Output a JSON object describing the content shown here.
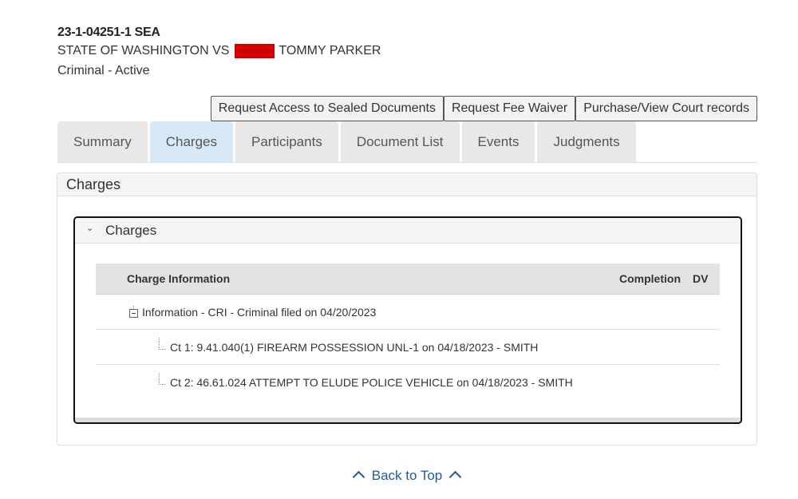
{
  "case": {
    "number": "23-1-04251-1 SEA",
    "title_prefix": "STATE OF WASHINGTON VS",
    "title_suffix": "TOMMY PARKER",
    "status": "Criminal - Active",
    "redaction_color": "#d40000"
  },
  "actions": {
    "sealed_docs": "Request Access to Sealed Documents",
    "fee_waiver": "Request Fee Waiver",
    "court_records": "Purchase/View Court records"
  },
  "tabs": [
    {
      "label": "Summary",
      "active": false
    },
    {
      "label": "Charges",
      "active": true
    },
    {
      "label": "Participants",
      "active": false
    },
    {
      "label": "Document List",
      "active": false
    },
    {
      "label": "Events",
      "active": false
    },
    {
      "label": "Judgments",
      "active": false
    }
  ],
  "panel": {
    "title": "Charges",
    "section_title": "Charges",
    "section_icon": "chevron-down-icon",
    "columns": {
      "info": "Charge Information",
      "completion": "Completion",
      "dv": "DV"
    },
    "filing": {
      "label": "Information - CRI - Criminal filed on 04/20/2023",
      "icon": "collapse-minus-icon"
    },
    "counts": [
      {
        "label": "Ct 1: 9.41.040(1) FIREARM POSSESSION UNL-1 on 04/18/2023 - SMITH"
      },
      {
        "label": "Ct 2: 46.61.024 ATTEMPT TO ELUDE POLICE VEHICLE on 04/18/2023 - SMITH"
      }
    ]
  },
  "footer": {
    "back_to_top": "Back to Top",
    "icon": "caret-up-icon",
    "link_color": "#1f5a9a"
  }
}
